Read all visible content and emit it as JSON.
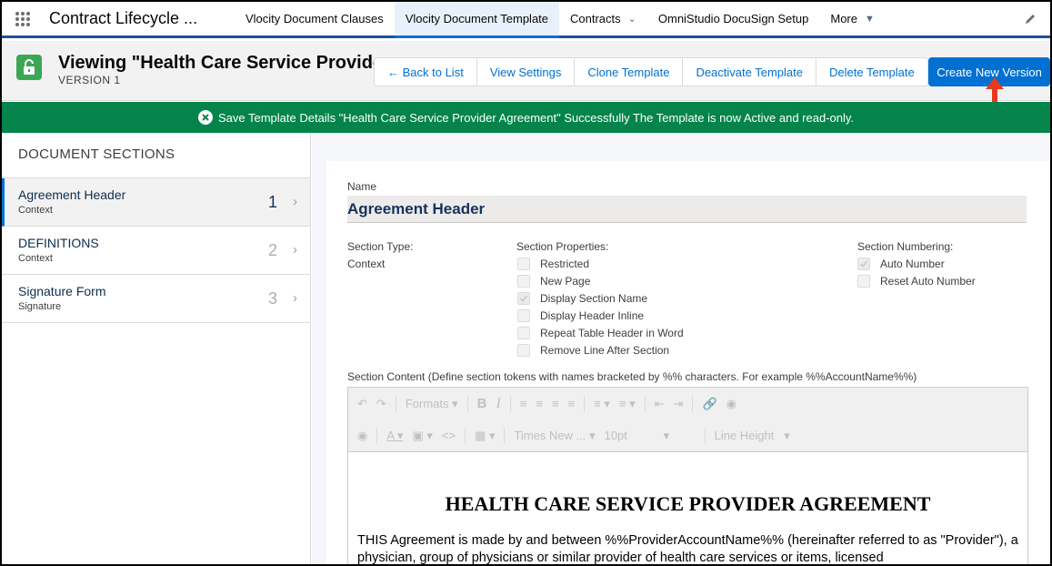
{
  "nav": {
    "app_name": "Contract Lifecycle ...",
    "tabs": [
      {
        "label": "Vlocity Document Clauses"
      },
      {
        "label": "Vlocity Document Template"
      },
      {
        "label": "Contracts"
      },
      {
        "label": "OmniStudio DocuSign Setup"
      },
      {
        "label": "More"
      }
    ],
    "active_tab": "Vlocity Document Template"
  },
  "record": {
    "title": "Viewing \"Health Care Service Provide...",
    "subtitle": "VERSION 1",
    "buttons": {
      "back": "← Back to List",
      "view_settings": "View Settings",
      "clone": "Clone Template",
      "deactivate": "Deactivate Template",
      "delete": "Delete Template",
      "create_version": "Create New Version"
    }
  },
  "toast": {
    "message": "Save Template Details \"Health Care Service Provider Agreement\" Successfully The Template is now Active and read-only."
  },
  "sidebar": {
    "heading": "DOCUMENT SECTIONS",
    "sections": [
      {
        "name": "Agreement Header",
        "type": "Context",
        "number": "1"
      },
      {
        "name": "DEFINITIONS",
        "type": "Context",
        "number": "2"
      },
      {
        "name": "Signature Form",
        "type": "Signature",
        "number": "3"
      }
    ]
  },
  "detail": {
    "name_label": "Name",
    "name_value": "Agreement Header",
    "section_type_label": "Section Type:",
    "section_type_value": "Context",
    "properties_label": "Section Properties:",
    "properties": [
      {
        "label": "Restricted",
        "checked": false
      },
      {
        "label": "New Page",
        "checked": false
      },
      {
        "label": "Display Section Name",
        "checked": true
      },
      {
        "label": "Display Header Inline",
        "checked": false
      },
      {
        "label": "Repeat Table Header in Word",
        "checked": false
      },
      {
        "label": "Remove Line After Section",
        "checked": false
      }
    ],
    "numbering_label": "Section Numbering:",
    "numbering": [
      {
        "label": "Auto Number",
        "checked": true
      },
      {
        "label": "Reset Auto Number",
        "checked": false
      }
    ],
    "content_label": "Section Content (Define section tokens with names bracketed by %% characters. For example %%AccountName%%)"
  },
  "editor": {
    "formats": "Formats",
    "font_family": "Times New ...",
    "font_size": "10pt",
    "line_height": "Line Height",
    "doc_title": "HEALTH CARE SERVICE PROVIDER AGREEMENT",
    "doc_body": "THIS Agreement  is made by and between %%ProviderAccountName%% (hereinafter referred to as \"Provider\"), a physician, group of physicians or similar provider of health care services or items, licensed"
  },
  "colors": {
    "brand": "#0070d2",
    "success": "#04844b",
    "lock": "#3ba755",
    "annotation_arrow": "#e8391d"
  }
}
